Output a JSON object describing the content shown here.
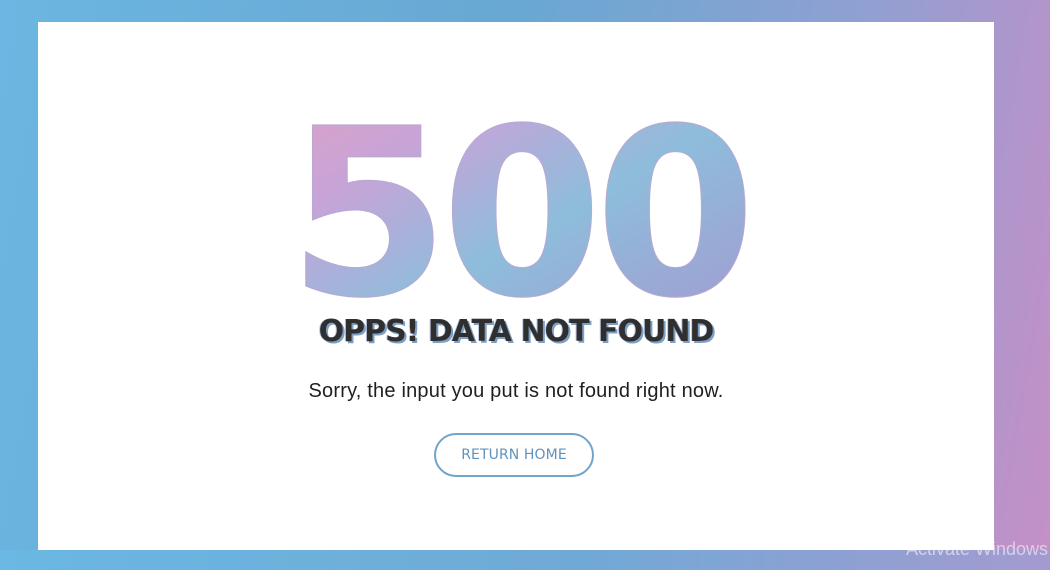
{
  "error_page": {
    "code": "500",
    "title": "OPPS! DATA NOT FOUND",
    "message": "Sorry, the input you put is not found right now.",
    "button_label": "RETURN HOME"
  },
  "system": {
    "watermark": "Activate Windows"
  },
  "colors": {
    "background_start": "#6bb6e2",
    "background_end": "#c58fc7",
    "code_gradient": [
      "#e0a2c0",
      "#c8a3d8",
      "#8ebddb",
      "#a497cf"
    ],
    "button_border": "#6fa5c8"
  }
}
